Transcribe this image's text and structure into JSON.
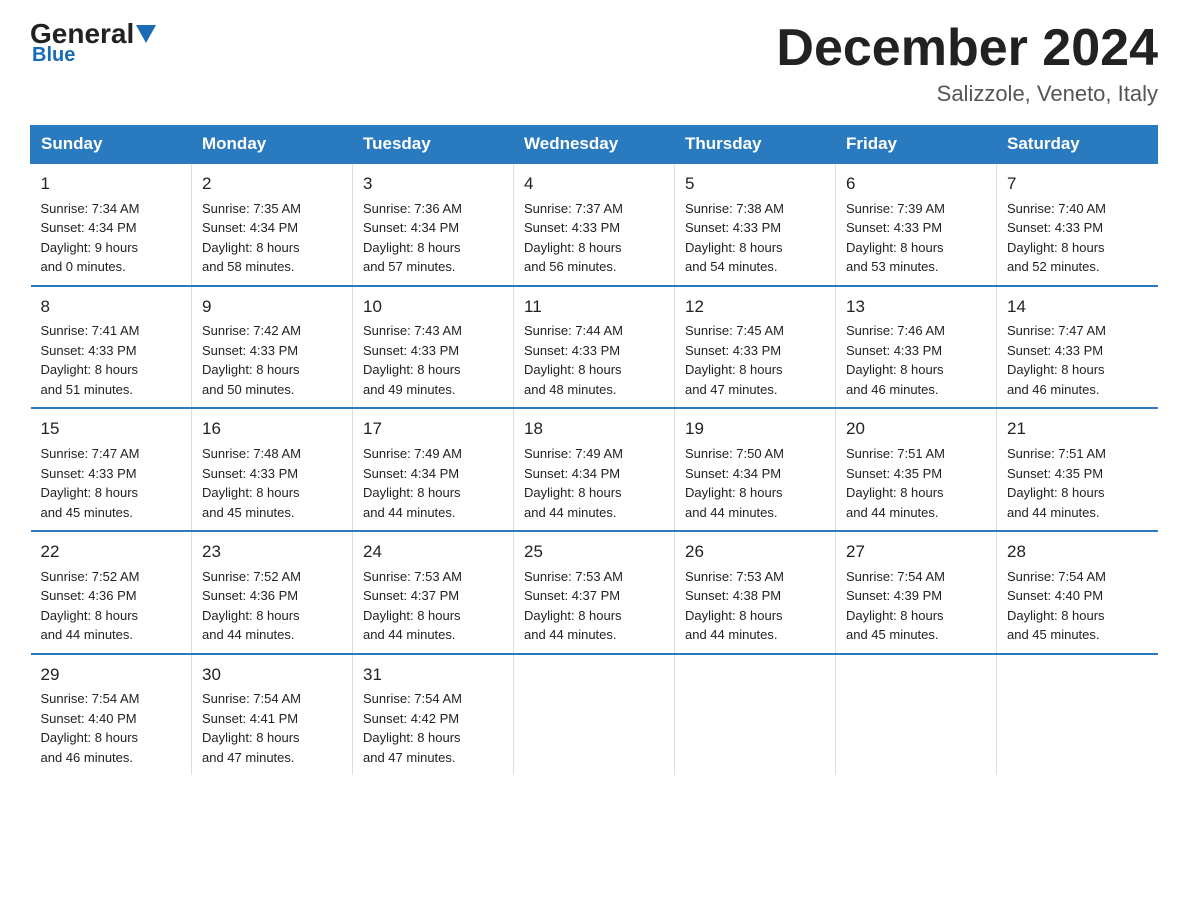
{
  "logo": {
    "general": "General",
    "blue": "Blue"
  },
  "title": "December 2024",
  "location": "Salizzole, Veneto, Italy",
  "days_of_week": [
    "Sunday",
    "Monday",
    "Tuesday",
    "Wednesday",
    "Thursday",
    "Friday",
    "Saturday"
  ],
  "weeks": [
    [
      {
        "day": "1",
        "info": "Sunrise: 7:34 AM\nSunset: 4:34 PM\nDaylight: 9 hours\nand 0 minutes."
      },
      {
        "day": "2",
        "info": "Sunrise: 7:35 AM\nSunset: 4:34 PM\nDaylight: 8 hours\nand 58 minutes."
      },
      {
        "day": "3",
        "info": "Sunrise: 7:36 AM\nSunset: 4:34 PM\nDaylight: 8 hours\nand 57 minutes."
      },
      {
        "day": "4",
        "info": "Sunrise: 7:37 AM\nSunset: 4:33 PM\nDaylight: 8 hours\nand 56 minutes."
      },
      {
        "day": "5",
        "info": "Sunrise: 7:38 AM\nSunset: 4:33 PM\nDaylight: 8 hours\nand 54 minutes."
      },
      {
        "day": "6",
        "info": "Sunrise: 7:39 AM\nSunset: 4:33 PM\nDaylight: 8 hours\nand 53 minutes."
      },
      {
        "day": "7",
        "info": "Sunrise: 7:40 AM\nSunset: 4:33 PM\nDaylight: 8 hours\nand 52 minutes."
      }
    ],
    [
      {
        "day": "8",
        "info": "Sunrise: 7:41 AM\nSunset: 4:33 PM\nDaylight: 8 hours\nand 51 minutes."
      },
      {
        "day": "9",
        "info": "Sunrise: 7:42 AM\nSunset: 4:33 PM\nDaylight: 8 hours\nand 50 minutes."
      },
      {
        "day": "10",
        "info": "Sunrise: 7:43 AM\nSunset: 4:33 PM\nDaylight: 8 hours\nand 49 minutes."
      },
      {
        "day": "11",
        "info": "Sunrise: 7:44 AM\nSunset: 4:33 PM\nDaylight: 8 hours\nand 48 minutes."
      },
      {
        "day": "12",
        "info": "Sunrise: 7:45 AM\nSunset: 4:33 PM\nDaylight: 8 hours\nand 47 minutes."
      },
      {
        "day": "13",
        "info": "Sunrise: 7:46 AM\nSunset: 4:33 PM\nDaylight: 8 hours\nand 46 minutes."
      },
      {
        "day": "14",
        "info": "Sunrise: 7:47 AM\nSunset: 4:33 PM\nDaylight: 8 hours\nand 46 minutes."
      }
    ],
    [
      {
        "day": "15",
        "info": "Sunrise: 7:47 AM\nSunset: 4:33 PM\nDaylight: 8 hours\nand 45 minutes."
      },
      {
        "day": "16",
        "info": "Sunrise: 7:48 AM\nSunset: 4:33 PM\nDaylight: 8 hours\nand 45 minutes."
      },
      {
        "day": "17",
        "info": "Sunrise: 7:49 AM\nSunset: 4:34 PM\nDaylight: 8 hours\nand 44 minutes."
      },
      {
        "day": "18",
        "info": "Sunrise: 7:49 AM\nSunset: 4:34 PM\nDaylight: 8 hours\nand 44 minutes."
      },
      {
        "day": "19",
        "info": "Sunrise: 7:50 AM\nSunset: 4:34 PM\nDaylight: 8 hours\nand 44 minutes."
      },
      {
        "day": "20",
        "info": "Sunrise: 7:51 AM\nSunset: 4:35 PM\nDaylight: 8 hours\nand 44 minutes."
      },
      {
        "day": "21",
        "info": "Sunrise: 7:51 AM\nSunset: 4:35 PM\nDaylight: 8 hours\nand 44 minutes."
      }
    ],
    [
      {
        "day": "22",
        "info": "Sunrise: 7:52 AM\nSunset: 4:36 PM\nDaylight: 8 hours\nand 44 minutes."
      },
      {
        "day": "23",
        "info": "Sunrise: 7:52 AM\nSunset: 4:36 PM\nDaylight: 8 hours\nand 44 minutes."
      },
      {
        "day": "24",
        "info": "Sunrise: 7:53 AM\nSunset: 4:37 PM\nDaylight: 8 hours\nand 44 minutes."
      },
      {
        "day": "25",
        "info": "Sunrise: 7:53 AM\nSunset: 4:37 PM\nDaylight: 8 hours\nand 44 minutes."
      },
      {
        "day": "26",
        "info": "Sunrise: 7:53 AM\nSunset: 4:38 PM\nDaylight: 8 hours\nand 44 minutes."
      },
      {
        "day": "27",
        "info": "Sunrise: 7:54 AM\nSunset: 4:39 PM\nDaylight: 8 hours\nand 45 minutes."
      },
      {
        "day": "28",
        "info": "Sunrise: 7:54 AM\nSunset: 4:40 PM\nDaylight: 8 hours\nand 45 minutes."
      }
    ],
    [
      {
        "day": "29",
        "info": "Sunrise: 7:54 AM\nSunset: 4:40 PM\nDaylight: 8 hours\nand 46 minutes."
      },
      {
        "day": "30",
        "info": "Sunrise: 7:54 AM\nSunset: 4:41 PM\nDaylight: 8 hours\nand 47 minutes."
      },
      {
        "day": "31",
        "info": "Sunrise: 7:54 AM\nSunset: 4:42 PM\nDaylight: 8 hours\nand 47 minutes."
      },
      {
        "day": "",
        "info": ""
      },
      {
        "day": "",
        "info": ""
      },
      {
        "day": "",
        "info": ""
      },
      {
        "day": "",
        "info": ""
      }
    ]
  ]
}
